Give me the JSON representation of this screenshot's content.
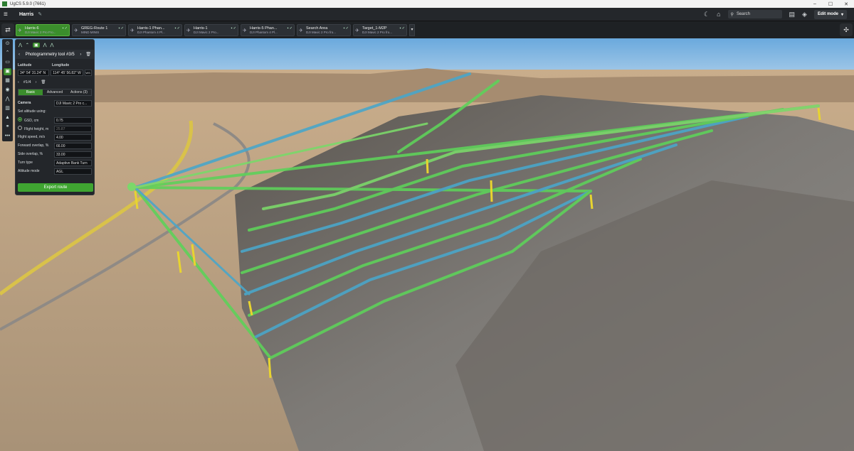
{
  "window": {
    "title": "UgCS 5.9.0 (7661)"
  },
  "menubar": {
    "project": "Harris",
    "search_placeholder": "Search",
    "edit_mode": "Edit mode"
  },
  "tabs": [
    {
      "name": "Harris-6",
      "sub": "DJI Mavic 2 Pro Fro...",
      "active": true
    },
    {
      "name": "GREG-Route 1",
      "sub": "MIND MINIS",
      "active": false
    },
    {
      "name": "Harris-1 Phan...",
      "sub": "DJI Phantom 4 Pl...",
      "active": false
    },
    {
      "name": "Harris-1",
      "sub": "DJI Mavic 2 Pro...",
      "active": false
    },
    {
      "name": "Harris-5 Phan...",
      "sub": "DJI Phantom 4 Pl...",
      "active": false
    },
    {
      "name": "Search Area",
      "sub": "DJI Mavic 2 Pro fro...",
      "active": false
    },
    {
      "name": "Target_1-M2P",
      "sub": "DJI Mavic 2 Pro fro...",
      "active": false
    }
  ],
  "panel": {
    "tool_title": "Photogrammetry tool #3/5",
    "latitude_label": "Latitude",
    "longitude_label": "Longitude",
    "latitude_value": "34° 54' 31.24\" N",
    "longitude_value": "114° 45' 56.82\" W",
    "alt_unit": "WS",
    "point_index": "#1/4",
    "seg_basic": "Basic",
    "seg_advanced": "Advanced",
    "seg_actions": "Actions (3)",
    "camera_label": "Camera",
    "camera_value": "DJI Mavic 2 Pro c...",
    "set_alt_label": "Set altitude using:",
    "gsd_label": "GSD, cm",
    "gsd_value": "0.75",
    "flight_height_label": "Flight height, m",
    "flight_height_value": "25.87",
    "speed_label": "Flight speed, m/s",
    "speed_value": "4.00",
    "fwd_label": "Forward overlap, %",
    "fwd_value": "66.00",
    "side_label": "Side overlap, %",
    "side_value": "33.00",
    "turn_label": "Turn type",
    "turn_value": "Adaptive Bank Turn",
    "altmode_label": "Altitude mode",
    "altmode_value": "AGL",
    "export_label": "Export route"
  },
  "colors": {
    "accent": "#3b8e2c",
    "route_green": "#5ed15a",
    "route_blue": "#4aa6c9",
    "waypoint_yellow": "#e8d430"
  }
}
